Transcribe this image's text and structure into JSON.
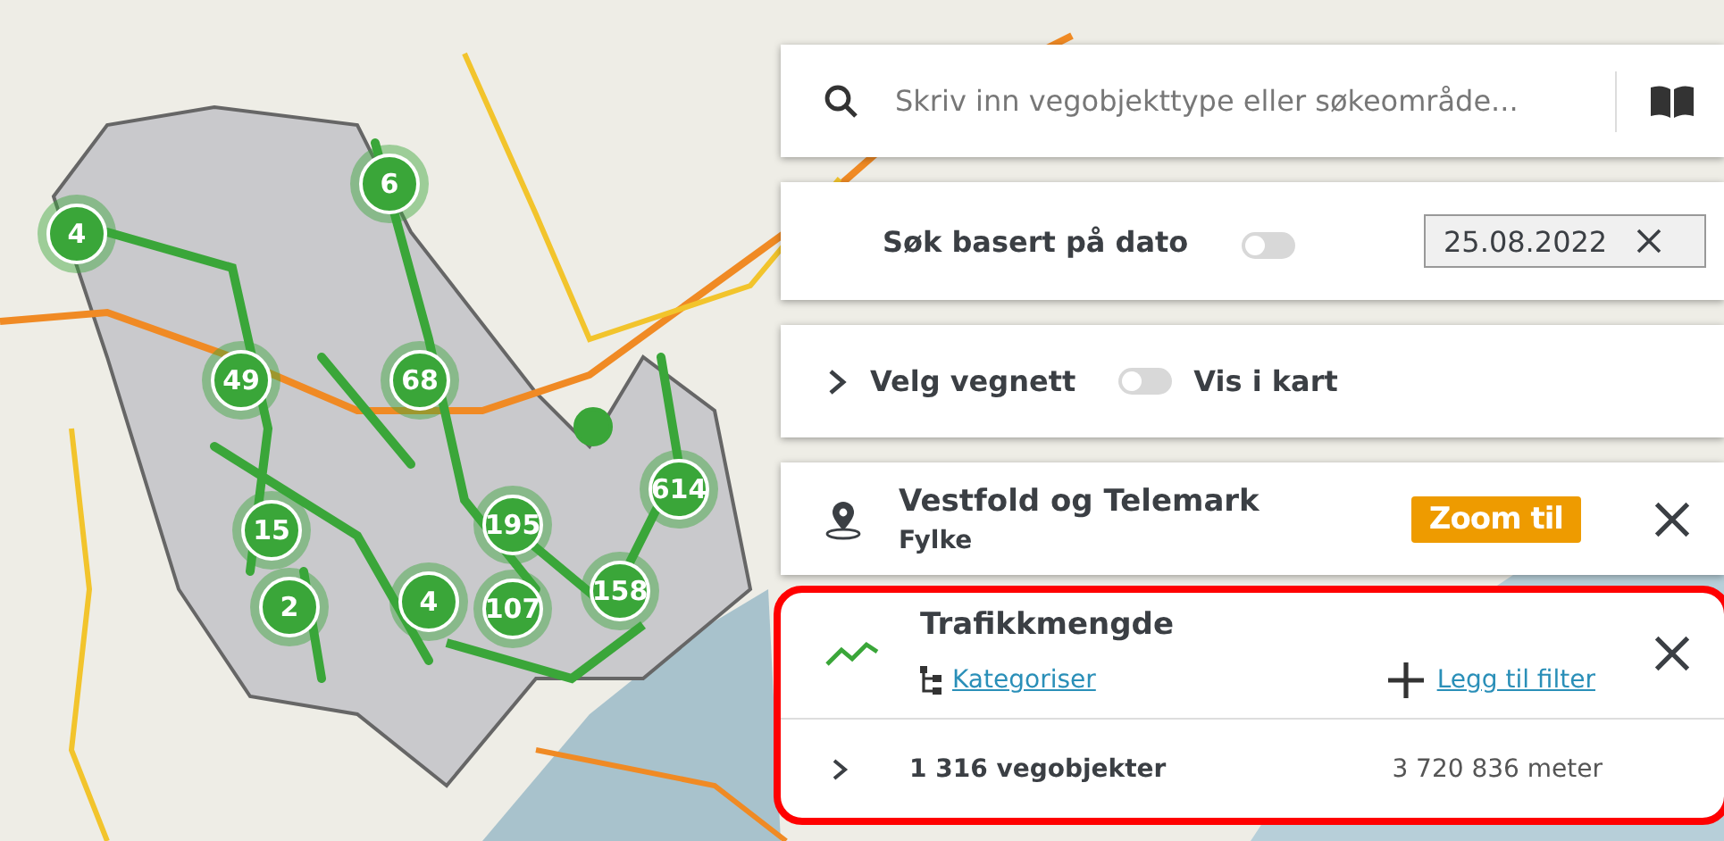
{
  "map": {
    "markers": [
      {
        "kind": "cluster",
        "label": "4"
      },
      {
        "kind": "cluster",
        "label": "6"
      },
      {
        "kind": "cluster",
        "label": "49"
      },
      {
        "kind": "cluster",
        "label": "68"
      },
      {
        "kind": "cluster",
        "label": "15"
      },
      {
        "kind": "cluster",
        "label": "2"
      },
      {
        "kind": "cluster",
        "label": "4"
      },
      {
        "kind": "cluster",
        "label": "195"
      },
      {
        "kind": "cluster",
        "label": "107"
      },
      {
        "kind": "cluster",
        "label": "158"
      },
      {
        "kind": "cluster",
        "label": "614"
      },
      {
        "kind": "point"
      }
    ]
  },
  "search": {
    "placeholder": "Skriv inn vegobjekttype eller søkeområde..."
  },
  "date_filter": {
    "label": "Søk basert på dato",
    "on": false,
    "value": "25.08.2022"
  },
  "road_network": {
    "label": "Velg vegnett",
    "expanded": false,
    "toggle": {
      "label": "Vis i kart",
      "on": false
    }
  },
  "area": {
    "title": "Vestfold og Telemark",
    "subtitle": "Fylke",
    "button": "Zoom til"
  },
  "object_type": {
    "title": "Trafikkmengde",
    "highlighted": true,
    "categorize": "Kategoriser",
    "add_filter": "Legg til filter",
    "count": "1 316 vegobjekter",
    "length": "3 720 836 meter",
    "expanded": false
  }
}
